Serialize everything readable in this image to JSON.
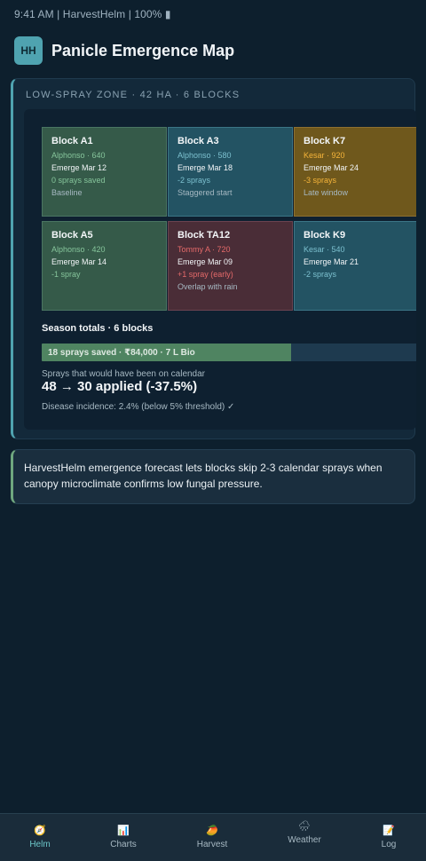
{
  "status_bar": {
    "text": "9:41 AM | HarvestHelm | 100% ▮"
  },
  "header": {
    "logo": "HH",
    "title": "Panicle Emergence Map"
  },
  "zone": {
    "label": "LOW-SPRAY ZONE · 42 HA · 6 BLOCKS",
    "blocks": [
      {
        "title": "Block A1",
        "variety": "Alphonso · 640",
        "emerge": "Emerge Mar 12",
        "sprays": "0 sprays saved",
        "note": "Baseline"
      },
      {
        "title": "Block A3",
        "variety": "Alphonso · 580",
        "emerge": "Emerge Mar 18",
        "sprays": "-2 sprays",
        "note": "Staggered start"
      },
      {
        "title": "Block K7",
        "variety": "Kesar · 920",
        "emerge": "Emerge Mar 24",
        "sprays": "-3 sprays",
        "note": "Late window"
      },
      {
        "title": "Block A5",
        "variety": "Alphonso · 420",
        "emerge": "Emerge Mar 14",
        "sprays": "-1 spray",
        "note": ""
      },
      {
        "title": "Block TA12",
        "variety": "Tommy A · 720",
        "emerge": "Emerge Mar 09",
        "sprays": "+1 spray (early)",
        "note": "Overlap with rain"
      },
      {
        "title": "Block K9",
        "variety": "Kesar · 540",
        "emerge": "Emerge Mar 21",
        "sprays": "-2 sprays",
        "note": ""
      }
    ],
    "season_totals": "Season totals · 6 blocks",
    "progress": {
      "text": "18 sprays saved · ₹84,000 · 7 L Bio",
      "fraction": 0.663
    },
    "calendar_label": "Sprays that would have been on calendar",
    "sprays_summary": "48 → 30 applied (-37.5%)",
    "disease": "Disease incidence: 2.4% (below 5% threshold) ✓"
  },
  "info": {
    "text": "HarvestHelm emergence forecast lets blocks skip 2-3 calendar sprays when canopy microclimate confirms low fungal pressure."
  },
  "nav": [
    {
      "icon": "🧭",
      "label": "Helm",
      "icon_name": "compass-icon",
      "active": true
    },
    {
      "icon": "📊",
      "label": "Charts",
      "icon_name": "bar-chart-icon",
      "active": false
    },
    {
      "icon": "🥭",
      "label": "Harvest",
      "icon_name": "mango-icon",
      "active": false
    },
    {
      "icon": "🌧",
      "label": "Weather",
      "icon_name": "rain-cloud-icon",
      "active": false
    },
    {
      "icon": "📝",
      "label": "Log",
      "icon_name": "memo-icon",
      "active": false
    }
  ],
  "colors": {
    "background": "#0d1f2d",
    "accent": "#4fa3b0",
    "active_nav": "#6cc7c9",
    "saved_bar": "#4f8461"
  }
}
